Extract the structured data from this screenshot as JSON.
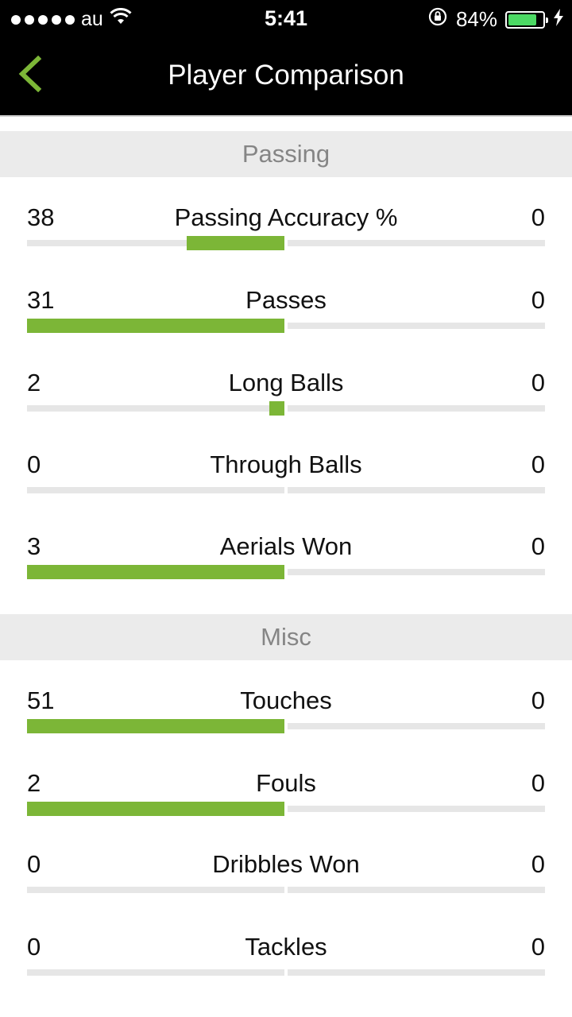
{
  "status_bar": {
    "carrier": "au",
    "time": "5:41",
    "battery_percent_text": "84%",
    "battery_level": 0.84
  },
  "nav": {
    "title": "Player Comparison",
    "back_icon": "chevron-left-icon",
    "accent_color": "#7cb637"
  },
  "sections": [
    {
      "title": "Passing",
      "stats": [
        {
          "label": "Passing Accuracy %",
          "left": "38",
          "right": "0",
          "left_fraction": 0.38,
          "right_fraction": 0
        },
        {
          "label": "Passes",
          "left": "31",
          "right": "0",
          "left_fraction": 1,
          "right_fraction": 0
        },
        {
          "label": "Long Balls",
          "left": "2",
          "right": "0",
          "left_fraction": 0.06,
          "right_fraction": 0
        },
        {
          "label": "Through Balls",
          "left": "0",
          "right": "0",
          "left_fraction": 0,
          "right_fraction": 0
        },
        {
          "label": "Aerials Won",
          "left": "3",
          "right": "0",
          "left_fraction": 1,
          "right_fraction": 0
        }
      ]
    },
    {
      "title": "Misc",
      "stats": [
        {
          "label": "Touches",
          "left": "51",
          "right": "0",
          "left_fraction": 1,
          "right_fraction": 0
        },
        {
          "label": "Fouls",
          "left": "2",
          "right": "0",
          "left_fraction": 1,
          "right_fraction": 0
        },
        {
          "label": "Dribbles Won",
          "left": "0",
          "right": "0",
          "left_fraction": 0,
          "right_fraction": 0
        },
        {
          "label": "Tackles",
          "left": "0",
          "right": "0",
          "left_fraction": 0,
          "right_fraction": 0
        }
      ]
    }
  ]
}
